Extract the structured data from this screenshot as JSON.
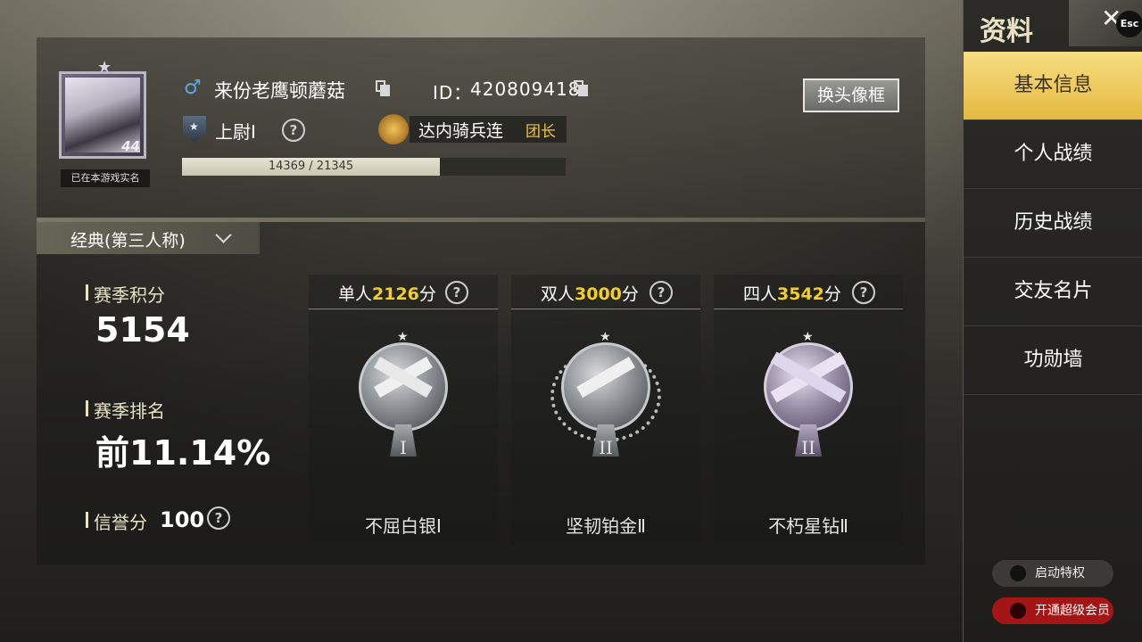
{
  "profile": {
    "avatar_level": "44",
    "realname_badge": "已在本游戏实名",
    "gender_symbol": "♂",
    "nickname": "来份老鹰顿蘑菇",
    "id_label": "ID：",
    "id_value": "420809418",
    "change_frame_label": "换头像框",
    "rank_name": "上尉Ⅰ",
    "clan_name": "达内骑兵连",
    "clan_role": "团长",
    "xp_text": "14369 / 21345",
    "xp_progress": 0.673
  },
  "mode": {
    "selected": "经典(第三人称)"
  },
  "stats": {
    "season_points_label": "赛季积分",
    "season_points_value": "5154",
    "season_rank_label": "赛季排名",
    "season_rank_value": "前11.14%",
    "honor_label": "信誉分",
    "honor_value": "100"
  },
  "cards": [
    {
      "title": "单人",
      "score": "2126",
      "unit": "分",
      "tier_numeral": "I",
      "rank_name": "不屈白银Ⅰ"
    },
    {
      "title": "双人",
      "score": "3000",
      "unit": "分",
      "tier_numeral": "II",
      "rank_name": "坚韧铂金Ⅱ"
    },
    {
      "title": "四人",
      "score": "3542",
      "unit": "分",
      "tier_numeral": "II",
      "rank_name": "不朽星钻Ⅱ"
    }
  ],
  "sidebar": {
    "title": "资料",
    "esc_label": "Esc",
    "items": [
      {
        "label": "基本信息",
        "active": true
      },
      {
        "label": "个人战绩"
      },
      {
        "label": "历史战绩"
      },
      {
        "label": "交友名片"
      },
      {
        "label": "功勋墙"
      }
    ],
    "privilege_label": "启动特权",
    "vip_label": "开通超级会员"
  },
  "colors": {
    "accent_gold": "#f6d020",
    "clan_role": "#f6c431",
    "active_tab": "#e4b940",
    "vip_red": "#a41616"
  }
}
